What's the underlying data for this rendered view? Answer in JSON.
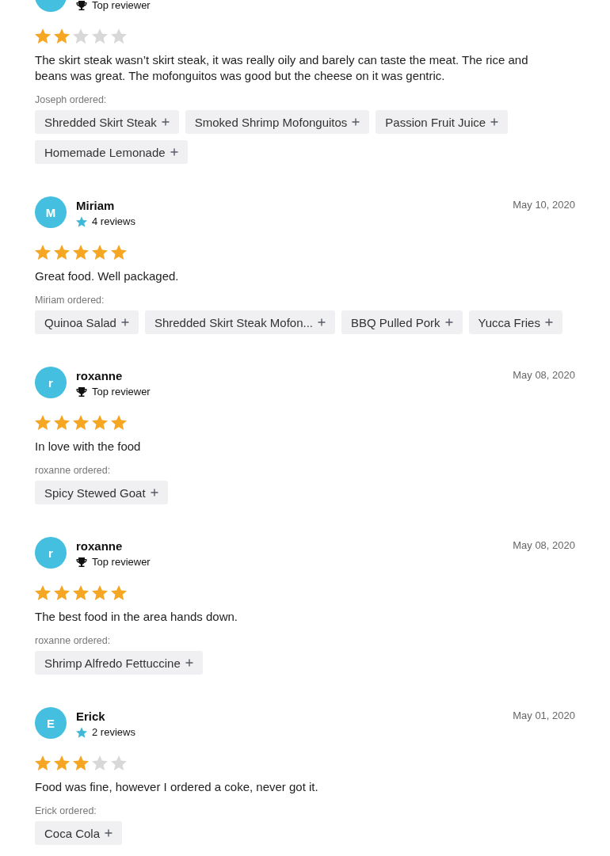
{
  "reviews": [
    {
      "badge": {
        "kind": "top_reviewer",
        "text": "Top reviewer"
      },
      "stars": 2,
      "text": "The skirt steak wasn’t skirt steak, it was really oily and barely can taste the meat. The rice and beans was great. The mofonguitos was good but the cheese on it was gentric.",
      "ordered_label": "Joseph ordered:",
      "items": [
        "Shredded Skirt Steak",
        "Smoked Shrimp Mofonguitos",
        "Passion Fruit Juice",
        "Homemade Lemonade"
      ]
    },
    {
      "initial": "M",
      "name": "Miriam",
      "date": "May 10, 2020",
      "badge": {
        "kind": "reviews",
        "text": "4 reviews"
      },
      "stars": 5,
      "text": "Great food. Well packaged.",
      "ordered_label": "Miriam ordered:",
      "items": [
        "Quinoa Salad",
        "Shredded Skirt Steak Mofon...",
        "BBQ Pulled Pork",
        "Yucca Fries"
      ]
    },
    {
      "initial": "r",
      "name": "roxanne",
      "date": "May 08, 2020",
      "badge": {
        "kind": "top_reviewer",
        "text": "Top reviewer"
      },
      "stars": 5,
      "text": "In love with the food",
      "ordered_label": "roxanne ordered:",
      "items": [
        "Spicy Stewed Goat"
      ]
    },
    {
      "initial": "r",
      "name": "roxanne",
      "date": "May 08, 2020",
      "badge": {
        "kind": "top_reviewer",
        "text": "Top reviewer"
      },
      "stars": 5,
      "text": "The best food in the area hands down.",
      "ordered_label": "roxanne ordered:",
      "items": [
        "Shrimp Alfredo Fettuccine"
      ]
    },
    {
      "initial": "E",
      "name": "Erick",
      "date": "May 01, 2020",
      "badge": {
        "kind": "reviews",
        "text": "2 reviews"
      },
      "stars": 3,
      "text": "Food was fine, however I ordered a coke, never got it.",
      "ordered_label": "Erick ordered:",
      "items": [
        "Coca Cola"
      ]
    }
  ]
}
